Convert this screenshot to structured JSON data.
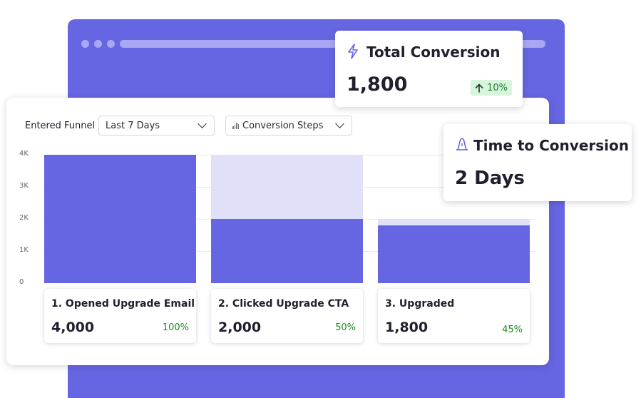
{
  "colors": {
    "accent": "#6666e3",
    "accent_light": "#e0e0f9",
    "window_dots": "#a8a8f2",
    "positive_green": "#1f8a1f",
    "badge_bg": "#d7f5dc"
  },
  "controls": {
    "funnel_label": "Entered Funnel",
    "date_range": "Last 7 Days",
    "view_mode": "Conversion Steps"
  },
  "steps": [
    {
      "title": "1. Opened Upgrade Email",
      "value": "4,000",
      "pct": "100%"
    },
    {
      "title": "2. Clicked Upgrade CTA",
      "value": "2,000",
      "pct": "50%"
    },
    {
      "title": "3. Upgraded",
      "value": "1,800",
      "pct": "45%"
    }
  ],
  "kpis": {
    "total_conversion": {
      "icon": "lightning-icon",
      "title": "Total Conversion",
      "value": "1,800",
      "change": "10%",
      "change_icon": "arrow-up-icon"
    },
    "time_to_conversion": {
      "icon": "bell-curve-icon",
      "title": "Time to Conversion",
      "value": "2 Days"
    }
  },
  "chart_data": {
    "type": "bar",
    "categories": [
      "1. Opened Upgrade Email",
      "2. Clicked Upgrade CTA",
      "3. Upgraded"
    ],
    "series": [
      {
        "values": [
          4000,
          2000,
          1800
        ]
      },
      {
        "values": [
          4000,
          4000,
          2000
        ]
      }
    ],
    "ylim": [
      0,
      4000
    ],
    "y_ticks": [
      "0",
      "1K",
      "2K",
      "3K",
      "4K"
    ],
    "grid": true
  }
}
